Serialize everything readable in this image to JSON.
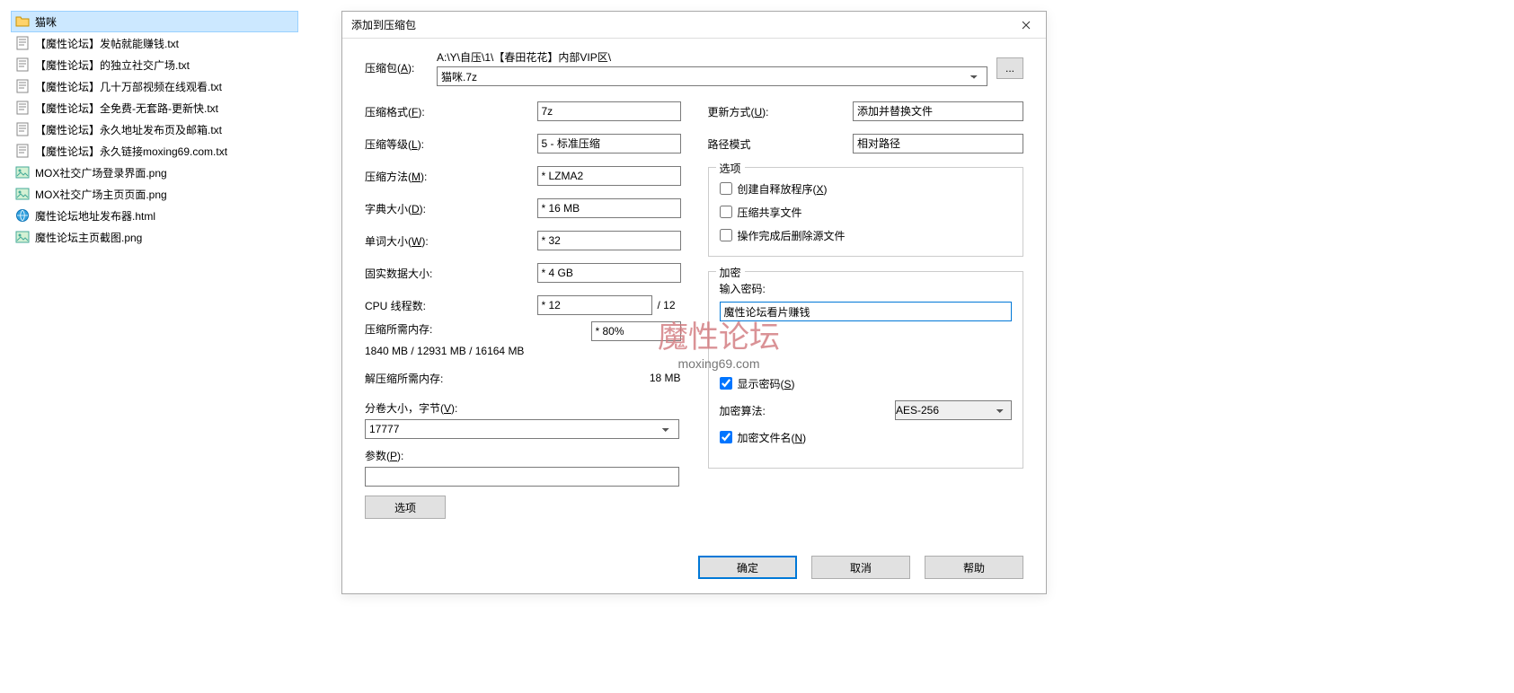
{
  "files": [
    {
      "name": "猫咪",
      "type": "folder",
      "selected": true
    },
    {
      "name": "【魔性论坛】发帖就能赚钱.txt",
      "type": "txt"
    },
    {
      "name": "【魔性论坛】的独立社交广场.txt",
      "type": "txt"
    },
    {
      "name": "【魔性论坛】几十万部视频在线观看.txt",
      "type": "txt"
    },
    {
      "name": "【魔性论坛】全免费-无套路-更新快.txt",
      "type": "txt"
    },
    {
      "name": "【魔性论坛】永久地址发布页及邮箱.txt",
      "type": "txt"
    },
    {
      "name": "【魔性论坛】永久链接moxing69.com.txt",
      "type": "txt"
    },
    {
      "name": "MOX社交广场登录界面.png",
      "type": "png"
    },
    {
      "name": "MOX社交广场主页页面.png",
      "type": "png"
    },
    {
      "name": "魔性论坛地址发布器.html",
      "type": "html"
    },
    {
      "name": "魔性论坛主页截图.png",
      "type": "png"
    }
  ],
  "dialog": {
    "title": "添加到压缩包",
    "archive_label": "压缩包(",
    "archive_label_u": "A",
    "archive_label_tail": "):",
    "path": "A:\\Y\\自压\\1\\【春田花花】内部VIP区\\",
    "archive_name": "猫咪.7z",
    "format_label": "压缩格式(",
    "format_u": "F",
    "format_tail": "):",
    "format_value": "7z",
    "level_label": "压缩等级(",
    "level_u": "L",
    "level_tail": "):",
    "level_value": "5 - 标准压缩",
    "method_label": "压缩方法(",
    "method_u": "M",
    "method_tail": "):",
    "method_value": "* LZMA2",
    "dict_label": "字典大小(",
    "dict_u": "D",
    "dict_tail": "):",
    "dict_value": "* 16 MB",
    "word_label": "单词大小(",
    "word_u": "W",
    "word_tail": "):",
    "word_value": "* 32",
    "solid_label": "固实数据大小:",
    "solid_value": "* 4 GB",
    "threads_label": "CPU 线程数:",
    "threads_value": "* 12",
    "threads_suffix": "/ 12",
    "mem_comp_label": "压缩所需内存:",
    "mem_comp_select": "* 80%",
    "mem_comp_line": "1840 MB / 12931 MB / 16164 MB",
    "mem_decomp_label": "解压缩所需内存:",
    "mem_decomp_value": "18 MB",
    "split_label": "分卷大小，字节(",
    "split_u": "V",
    "split_tail": "):",
    "split_value": "17777",
    "params_label": "参数(",
    "params_u": "P",
    "params_tail": "):",
    "params_value": "",
    "options_btn": "选项",
    "update_label": "更新方式(",
    "update_u": "U",
    "update_tail": "):",
    "update_value": "添加并替换文件",
    "pathmode_label": "路径模式",
    "pathmode_value": "相对路径",
    "options_legend": "选项",
    "opt_sfx": "创建自释放程序(",
    "opt_sfx_u": "X",
    "opt_sfx_tail": ")",
    "opt_shared": "压缩共享文件",
    "opt_delete": "操作完成后删除源文件",
    "enc_legend": "加密",
    "enc_pass_label": "输入密码:",
    "enc_pass_value": "魔性论坛看片赚钱",
    "enc_show": "显示密码(",
    "enc_show_u": "S",
    "enc_show_tail": ")",
    "enc_algo_label": "加密算法:",
    "enc_algo_value": "AES-256",
    "enc_names": "加密文件名(",
    "enc_names_u": "N",
    "enc_names_tail": ")",
    "ok": "确定",
    "cancel": "取消",
    "help": "帮助"
  },
  "watermark": {
    "line1": "魔性论坛",
    "line2": "moxing69.com"
  }
}
